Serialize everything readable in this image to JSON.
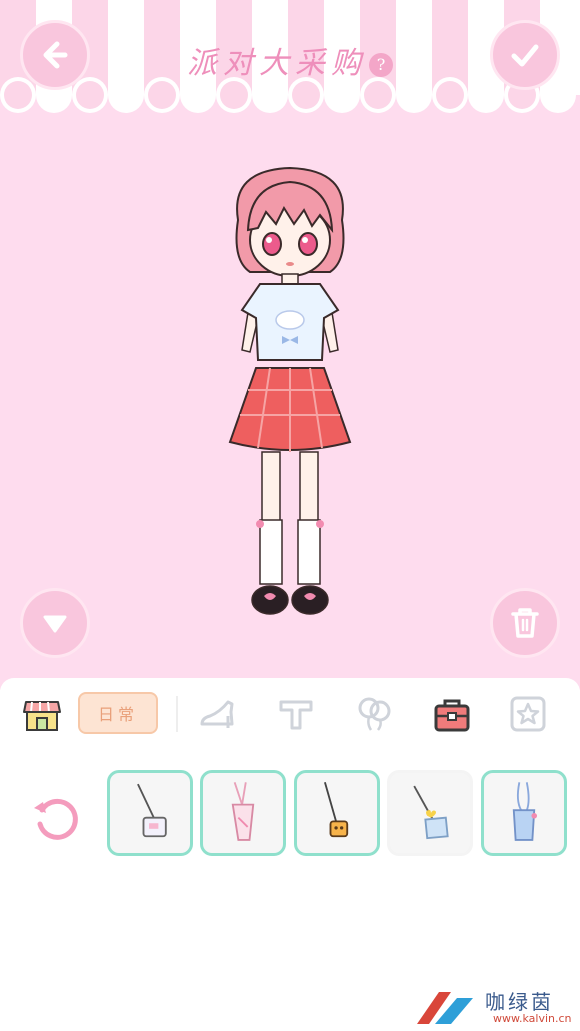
{
  "header": {
    "title": "派对大采购",
    "help_label": "?",
    "back_icon": "arrow-left-icon",
    "confirm_icon": "check-icon"
  },
  "stage": {
    "background_color": "#fedcee",
    "collapse_icon": "triangle-down-icon",
    "trash_icon": "trash-icon"
  },
  "categories": {
    "items": [
      {
        "icon": "shop-icon"
      },
      {
        "icon": "shoe-icon"
      },
      {
        "icon": "t-letter-icon"
      },
      {
        "icon": "balloon-icon"
      },
      {
        "icon": "bag-icon",
        "selected": true
      },
      {
        "icon": "star-icon"
      }
    ],
    "daily_tab_label": "日常"
  },
  "items": {
    "reset_icon": "refresh-icon",
    "list": [
      {
        "name": "white-crossbody-bag",
        "selected": true
      },
      {
        "name": "pink-tote-bag",
        "selected": true
      },
      {
        "name": "yellow-mini-bag",
        "selected": true
      },
      {
        "name": "blue-heart-bag",
        "selected": false
      },
      {
        "name": "blue-shoulder-bag",
        "selected": true
      }
    ],
    "accent_color": "#8fe0cc"
  },
  "watermark": {
    "name": "咖绿茵",
    "url": "www.kalvin.cn"
  }
}
